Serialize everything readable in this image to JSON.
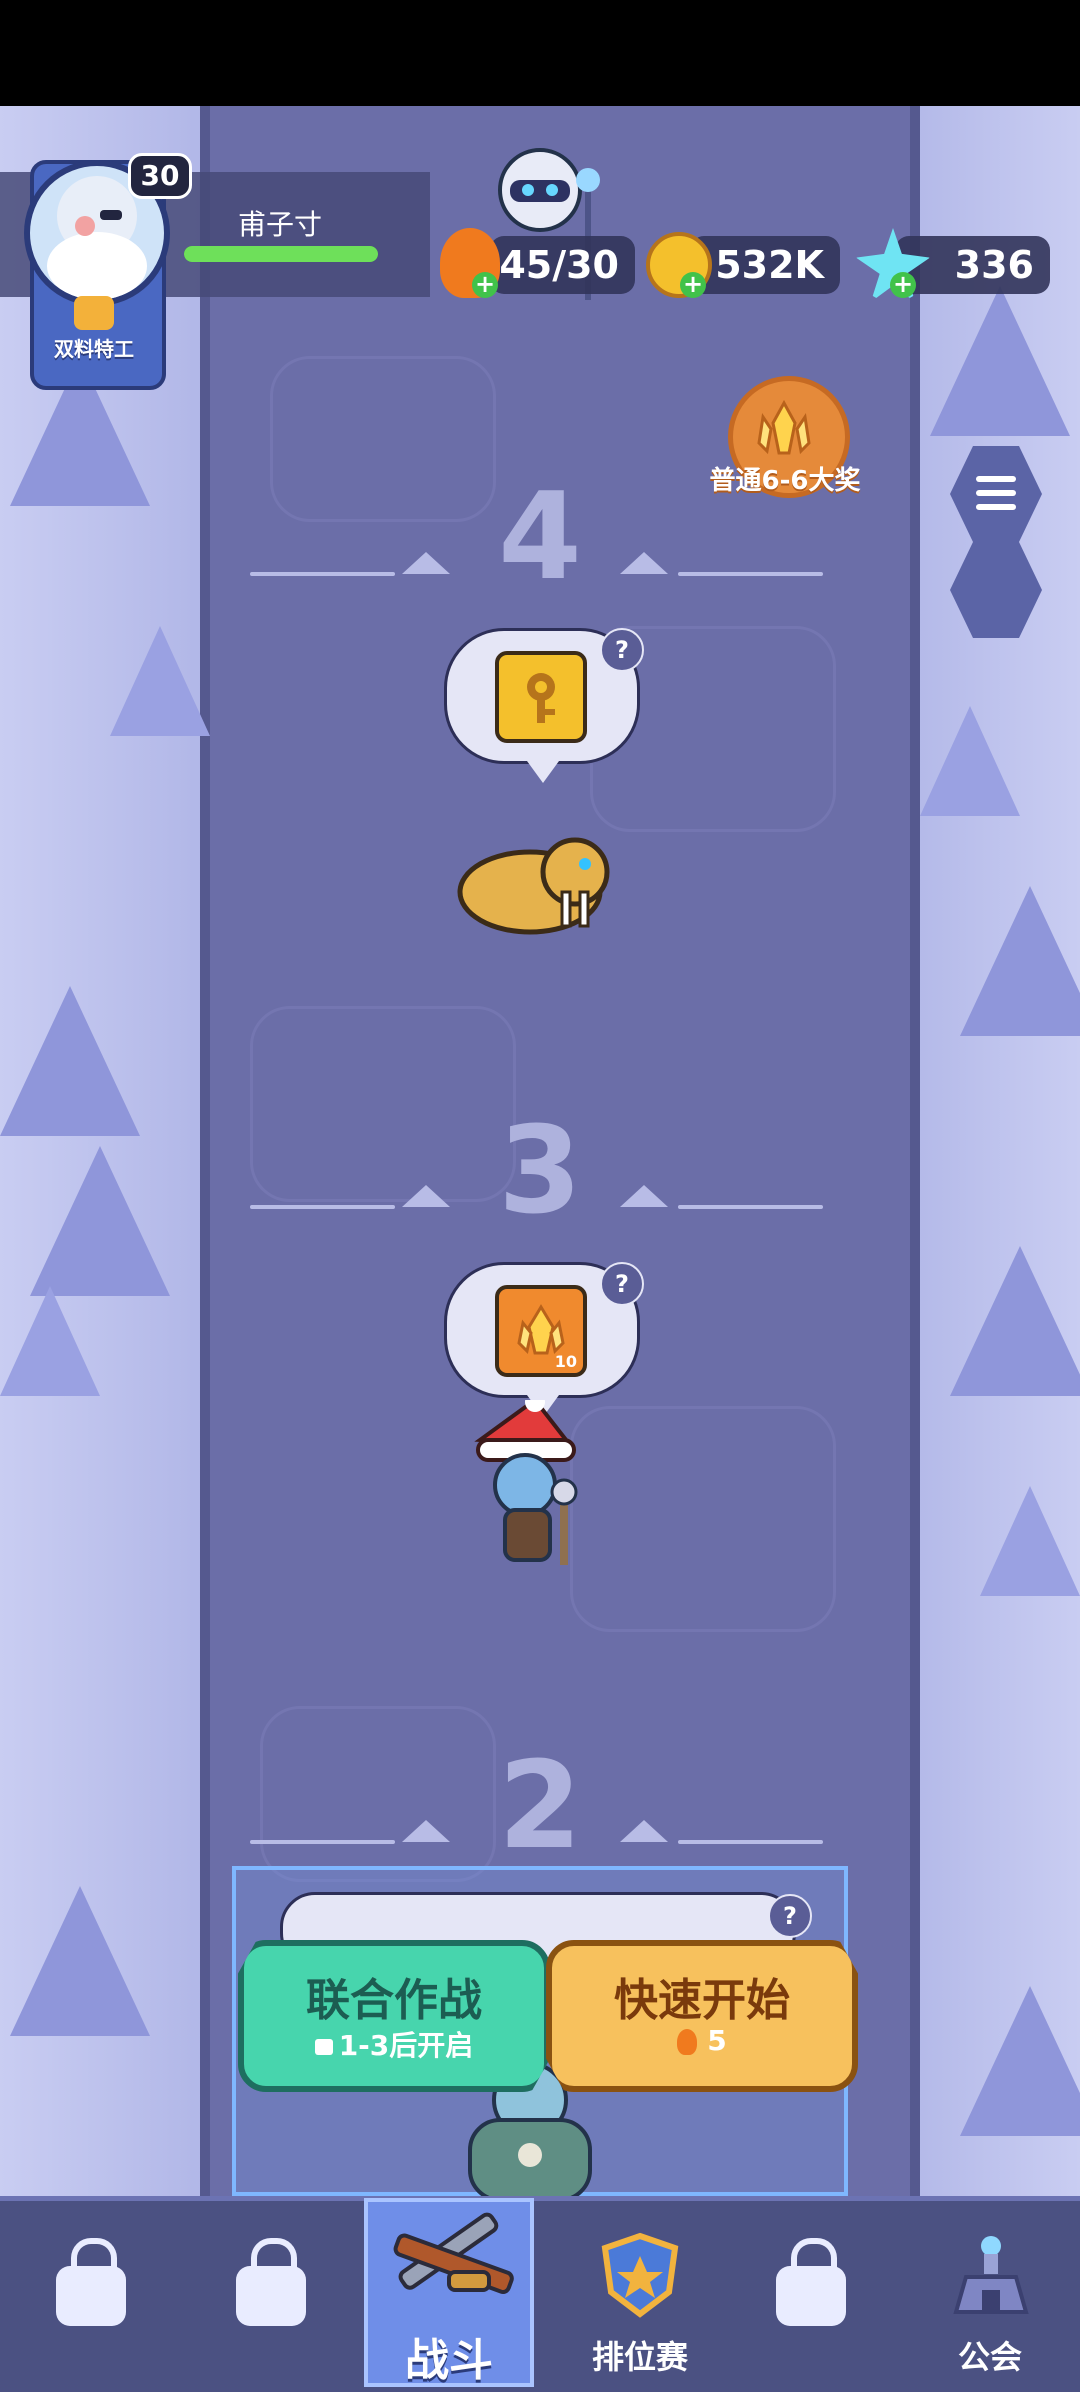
{
  "player": {
    "level": "30",
    "title": "双料特工",
    "name": "甫子寸",
    "xp_progress": 1.0
  },
  "resources": {
    "energy": "45/30",
    "gold": "532K",
    "gems": "336"
  },
  "event_reward": {
    "label": "普通6-6大奖"
  },
  "stages": [
    {
      "number": "4",
      "reward_icon": "key-icon",
      "reward_count": "",
      "enemy": "sabertooth-cat"
    },
    {
      "number": "3",
      "reward_icon": "crystal-icon",
      "reward_count": "10",
      "enemy": "goblin-santa-hat"
    },
    {
      "number": "2",
      "enemy": "armored-orc"
    }
  ],
  "buttons": {
    "coop": {
      "title": "联合作战",
      "sub": "1-3后开启"
    },
    "quick": {
      "title": "快速开始",
      "cost": "5"
    }
  },
  "nav": {
    "battle": "战斗",
    "ranked": "排位赛",
    "guild": "公会"
  },
  "colors": {
    "path": "#6b6ea8",
    "snow": "#b7bdea",
    "coop_button": "#47d5ad",
    "quick_button": "#f7c15d",
    "nav_bg": "#4b5182"
  }
}
